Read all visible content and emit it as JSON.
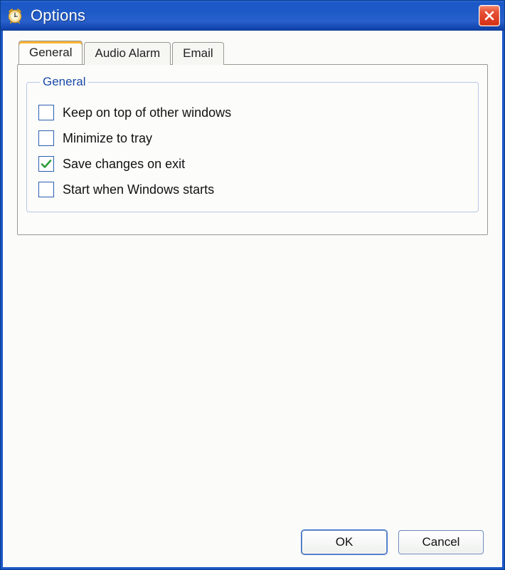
{
  "window": {
    "title": "Options"
  },
  "tabs": [
    {
      "label": "General",
      "active": true
    },
    {
      "label": "Audio Alarm",
      "active": false
    },
    {
      "label": "Email",
      "active": false
    }
  ],
  "group": {
    "legend": "General",
    "options": [
      {
        "label": "Keep on top of other windows",
        "checked": false
      },
      {
        "label": "Minimize to tray",
        "checked": false
      },
      {
        "label": "Save changes on exit",
        "checked": true
      },
      {
        "label": "Start when Windows starts",
        "checked": false
      }
    ]
  },
  "buttons": {
    "ok": "OK",
    "cancel": "Cancel"
  },
  "colors": {
    "titlebar_start": "#2a6ad3",
    "titlebar_end": "#0e3fa8",
    "accent_orange": "#f9b233",
    "check_green": "#2e9b3a"
  }
}
